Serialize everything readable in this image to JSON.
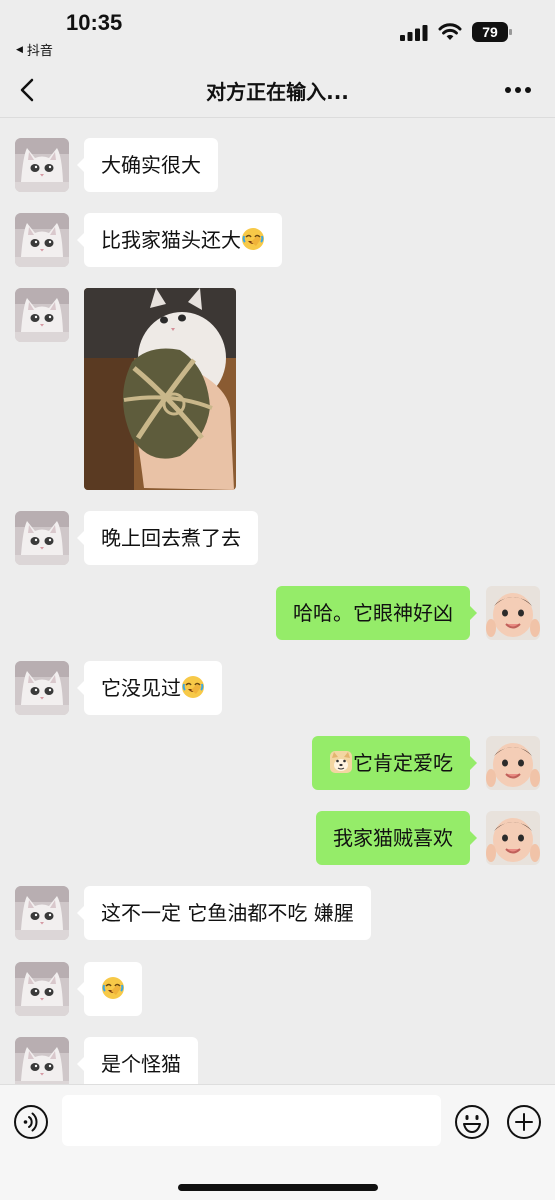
{
  "status_bar": {
    "time": "10:35",
    "back_app": "抖音",
    "battery": "79"
  },
  "nav": {
    "title": "对方正在输入..."
  },
  "messages": [
    {
      "side": "left",
      "text": "大确实很大"
    },
    {
      "side": "left",
      "text": "比我家猫头还大",
      "emoji": "facepalm-laugh-emoji"
    },
    {
      "side": "left",
      "type": "image",
      "image": "cat-with-hairy-crab-photo"
    },
    {
      "side": "left",
      "text": "晚上回去煮了去"
    },
    {
      "side": "right",
      "text": "哈哈。它眼神好凶"
    },
    {
      "side": "left",
      "text": "它没见过",
      "emoji": "facepalm-laugh-emoji"
    },
    {
      "side": "right",
      "text": "它肯定爱吃",
      "emoji_before": "doge-emoji"
    },
    {
      "side": "right",
      "text": "我家猫贼喜欢"
    },
    {
      "side": "left",
      "text": "这不一定 它鱼油都不吃 嫌腥"
    },
    {
      "side": "left",
      "type": "emoji_only",
      "emoji": "facepalm-laugh-emoji"
    },
    {
      "side": "left",
      "text": "是个怪猫"
    }
  ],
  "input": {
    "value": "",
    "placeholder": ""
  },
  "colors": {
    "background": "#ededed",
    "bubble_left": "#ffffff",
    "bubble_right": "#95ec69",
    "input_bar": "#f6f6f6"
  }
}
